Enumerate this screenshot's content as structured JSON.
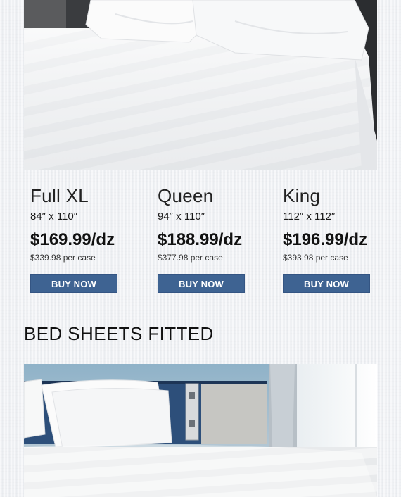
{
  "products": [
    {
      "name": "Full XL",
      "size": "84″ x 110″",
      "price": "$169.99/dz",
      "case_price": "$339.98 per case",
      "button": "BUY NOW"
    },
    {
      "name": "Queen",
      "size": "94″ x 110″",
      "price": "$188.99/dz",
      "case_price": "$377.98 per case",
      "button": "BUY NOW"
    },
    {
      "name": "King",
      "size": "112″ x 112″",
      "price": "$196.99/dz",
      "case_price": "$393.98 per case",
      "button": "BUY NOW"
    }
  ],
  "section": {
    "title": "BED SHEETS FITTED"
  },
  "colors": {
    "button": "#3e6392",
    "headboard_blue": "#2d4f7a",
    "background": "#eef0f3"
  }
}
